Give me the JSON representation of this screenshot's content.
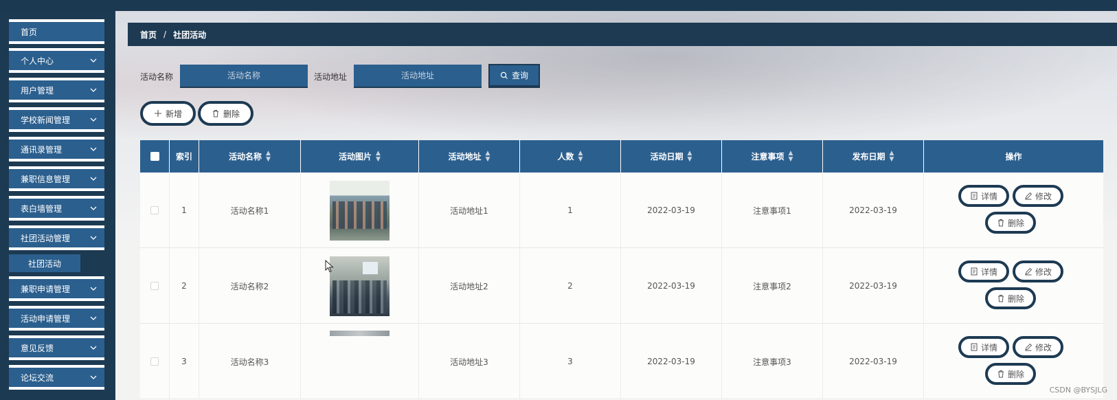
{
  "sidebar": {
    "items": [
      {
        "label": "首页",
        "has_chevron": false
      },
      {
        "label": "个人中心",
        "has_chevron": true
      },
      {
        "label": "用户管理",
        "has_chevron": true
      },
      {
        "label": "学校新闻管理",
        "has_chevron": true
      },
      {
        "label": "通讯录管理",
        "has_chevron": true
      },
      {
        "label": "兼职信息管理",
        "has_chevron": true
      },
      {
        "label": "表白墙管理",
        "has_chevron": true
      },
      {
        "label": "社团活动管理",
        "has_chevron": true
      },
      {
        "label": "兼职申请管理",
        "has_chevron": true
      },
      {
        "label": "活动申请管理",
        "has_chevron": true
      },
      {
        "label": "意见反馈",
        "has_chevron": true
      },
      {
        "label": "论坛交流",
        "has_chevron": true
      }
    ],
    "sub_item": "社团活动"
  },
  "breadcrumb": {
    "home": "首页",
    "separator": "/",
    "current": "社团活动"
  },
  "search": {
    "name_label": "活动名称",
    "name_placeholder": "活动名称",
    "address_label": "活动地址",
    "address_placeholder": "活动地址",
    "query_button": "查询"
  },
  "toolbar": {
    "add_button": "新增",
    "delete_button": "删除"
  },
  "table": {
    "headers": [
      "索引",
      "活动名称",
      "活动图片",
      "活动地址",
      "人数",
      "活动日期",
      "注意事项",
      "发布日期",
      "操作"
    ],
    "rows": [
      {
        "index": "1",
        "name": "活动名称1",
        "address": "活动地址1",
        "count": "1",
        "date": "2022-03-19",
        "notes": "注意事项1",
        "publish": "2022-03-19"
      },
      {
        "index": "2",
        "name": "活动名称2",
        "address": "活动地址2",
        "count": "2",
        "date": "2022-03-19",
        "notes": "注意事项2",
        "publish": "2022-03-19"
      },
      {
        "index": "3",
        "name": "活动名称3",
        "address": "活动地址3",
        "count": "3",
        "date": "2022-03-19",
        "notes": "注意事项3",
        "publish": "2022-03-19"
      }
    ],
    "actions": {
      "detail": "详情",
      "edit": "修改",
      "delete": "删除"
    }
  },
  "watermark": "CSDN @BYSJLG",
  "colors": {
    "primary": "#2b5f8e",
    "dark": "#1d3a52"
  }
}
